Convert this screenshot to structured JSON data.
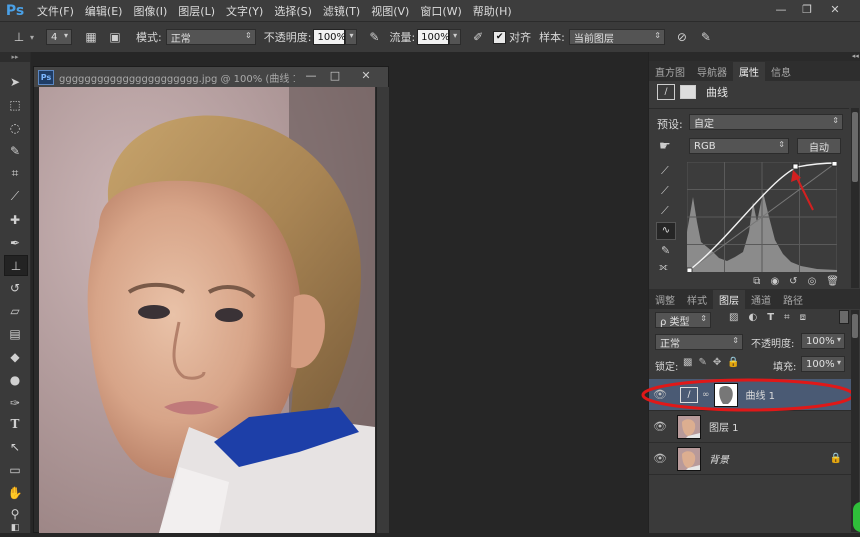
{
  "app": {
    "logo": "Ps"
  },
  "menu": [
    "文件(F)",
    "编辑(E)",
    "图像(I)",
    "图层(L)",
    "文字(Y)",
    "选择(S)",
    "滤镜(T)",
    "视图(V)",
    "窗口(W)",
    "帮助(H)"
  ],
  "window_controls": {
    "minimize": "—",
    "restore": "❐",
    "close": "✕"
  },
  "options": {
    "brush_size": "4",
    "mode_label": "模式:",
    "mode_value": "正常",
    "opacity_label": "不透明度:",
    "opacity_value": "100%",
    "flow_label": "流量:",
    "flow_value": "100%",
    "align_label": "对齐",
    "sample_label": "样本:",
    "sample_value": "当前图层"
  },
  "document": {
    "title": "gggggggggggggggggggggg.jpg @ 100% (曲线 1, ...",
    "icon": "Ps"
  },
  "properties_panel": {
    "tabs": [
      "直方图",
      "导航器",
      "属性",
      "信息"
    ],
    "active_tab": "属性",
    "header": "曲线",
    "preset_label": "预设:",
    "preset_value": "自定",
    "channel_value": "RGB",
    "auto_button": "自动"
  },
  "layers_panel": {
    "tabs": [
      "调整",
      "样式",
      "图层",
      "通道",
      "路径"
    ],
    "active_tab": "图层",
    "filter_value": "ρ 类型",
    "blend_value": "正常",
    "opacity_label": "不透明度:",
    "opacity_value": "100%",
    "lock_label": "锁定:",
    "fill_label": "填充:",
    "fill_value": "100%",
    "layers": [
      {
        "name": "曲线 1",
        "selected": true
      },
      {
        "name": "图层 1",
        "selected": false
      },
      {
        "name": "背景",
        "selected": false
      }
    ]
  },
  "colors": {
    "highlight_ellipse": "#e01818",
    "arrow": "#d32020",
    "selected_layer": "#4a5a74"
  }
}
